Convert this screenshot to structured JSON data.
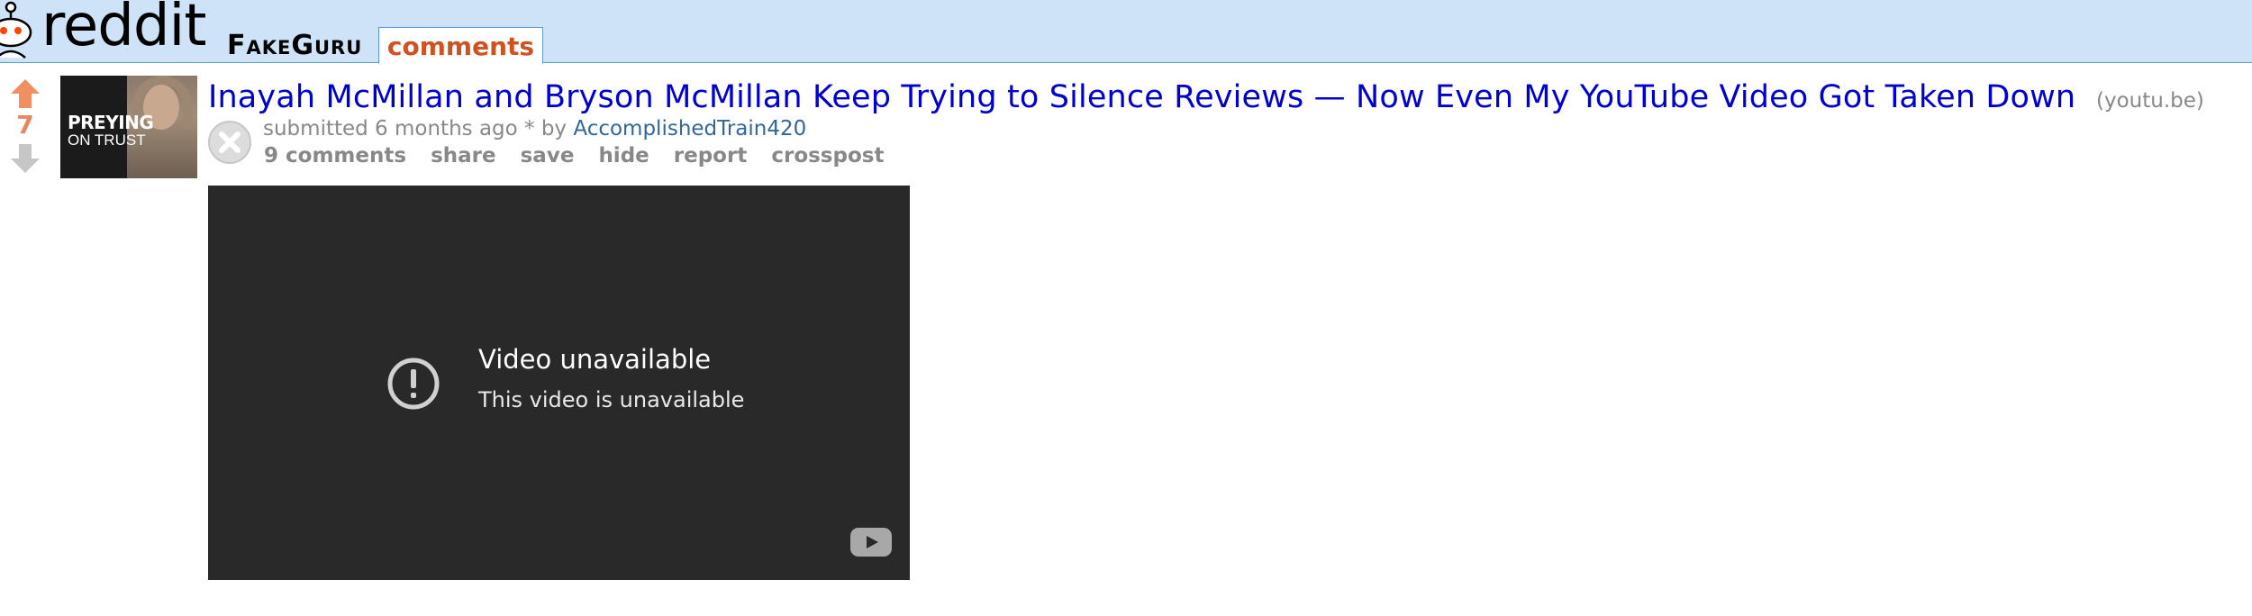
{
  "header": {
    "logo_text": "reddit",
    "subreddit": "FakeGuru",
    "tab_label": "comments",
    "colors": {
      "header_bg": "#cee3f8",
      "tab_text": "#ce5322"
    }
  },
  "post": {
    "score": "7",
    "thumbnail": {
      "line1": "PREYING",
      "line2": "ON TRUST"
    },
    "title": "Inayah McMillan and Bryson McMillan Keep Trying to Silence Reviews — Now Even My YouTube Video Got Taken Down",
    "domain": "(youtu.be)",
    "tagline": {
      "prefix": "submitted 6 months ago * by",
      "author": "AccomplishedTrain420"
    },
    "buttons": {
      "comments": "9 comments",
      "share": "share",
      "save": "save",
      "hide": "hide",
      "report": "report",
      "crosspost": "crosspost"
    },
    "icons": {
      "upvote": "upvote-arrow-icon",
      "downvote": "downvote-arrow-icon",
      "close": "close-circle-icon"
    },
    "colors": {
      "title": "#0000cc",
      "upvoted_score": "#e7875e",
      "author": "#336699"
    }
  },
  "video": {
    "title": "Video unavailable",
    "subtitle": "This video is unavailable",
    "icons": {
      "alert": "alert-circle-icon",
      "logo": "youtube-logo-icon"
    },
    "colors": {
      "bg": "#292929"
    }
  }
}
